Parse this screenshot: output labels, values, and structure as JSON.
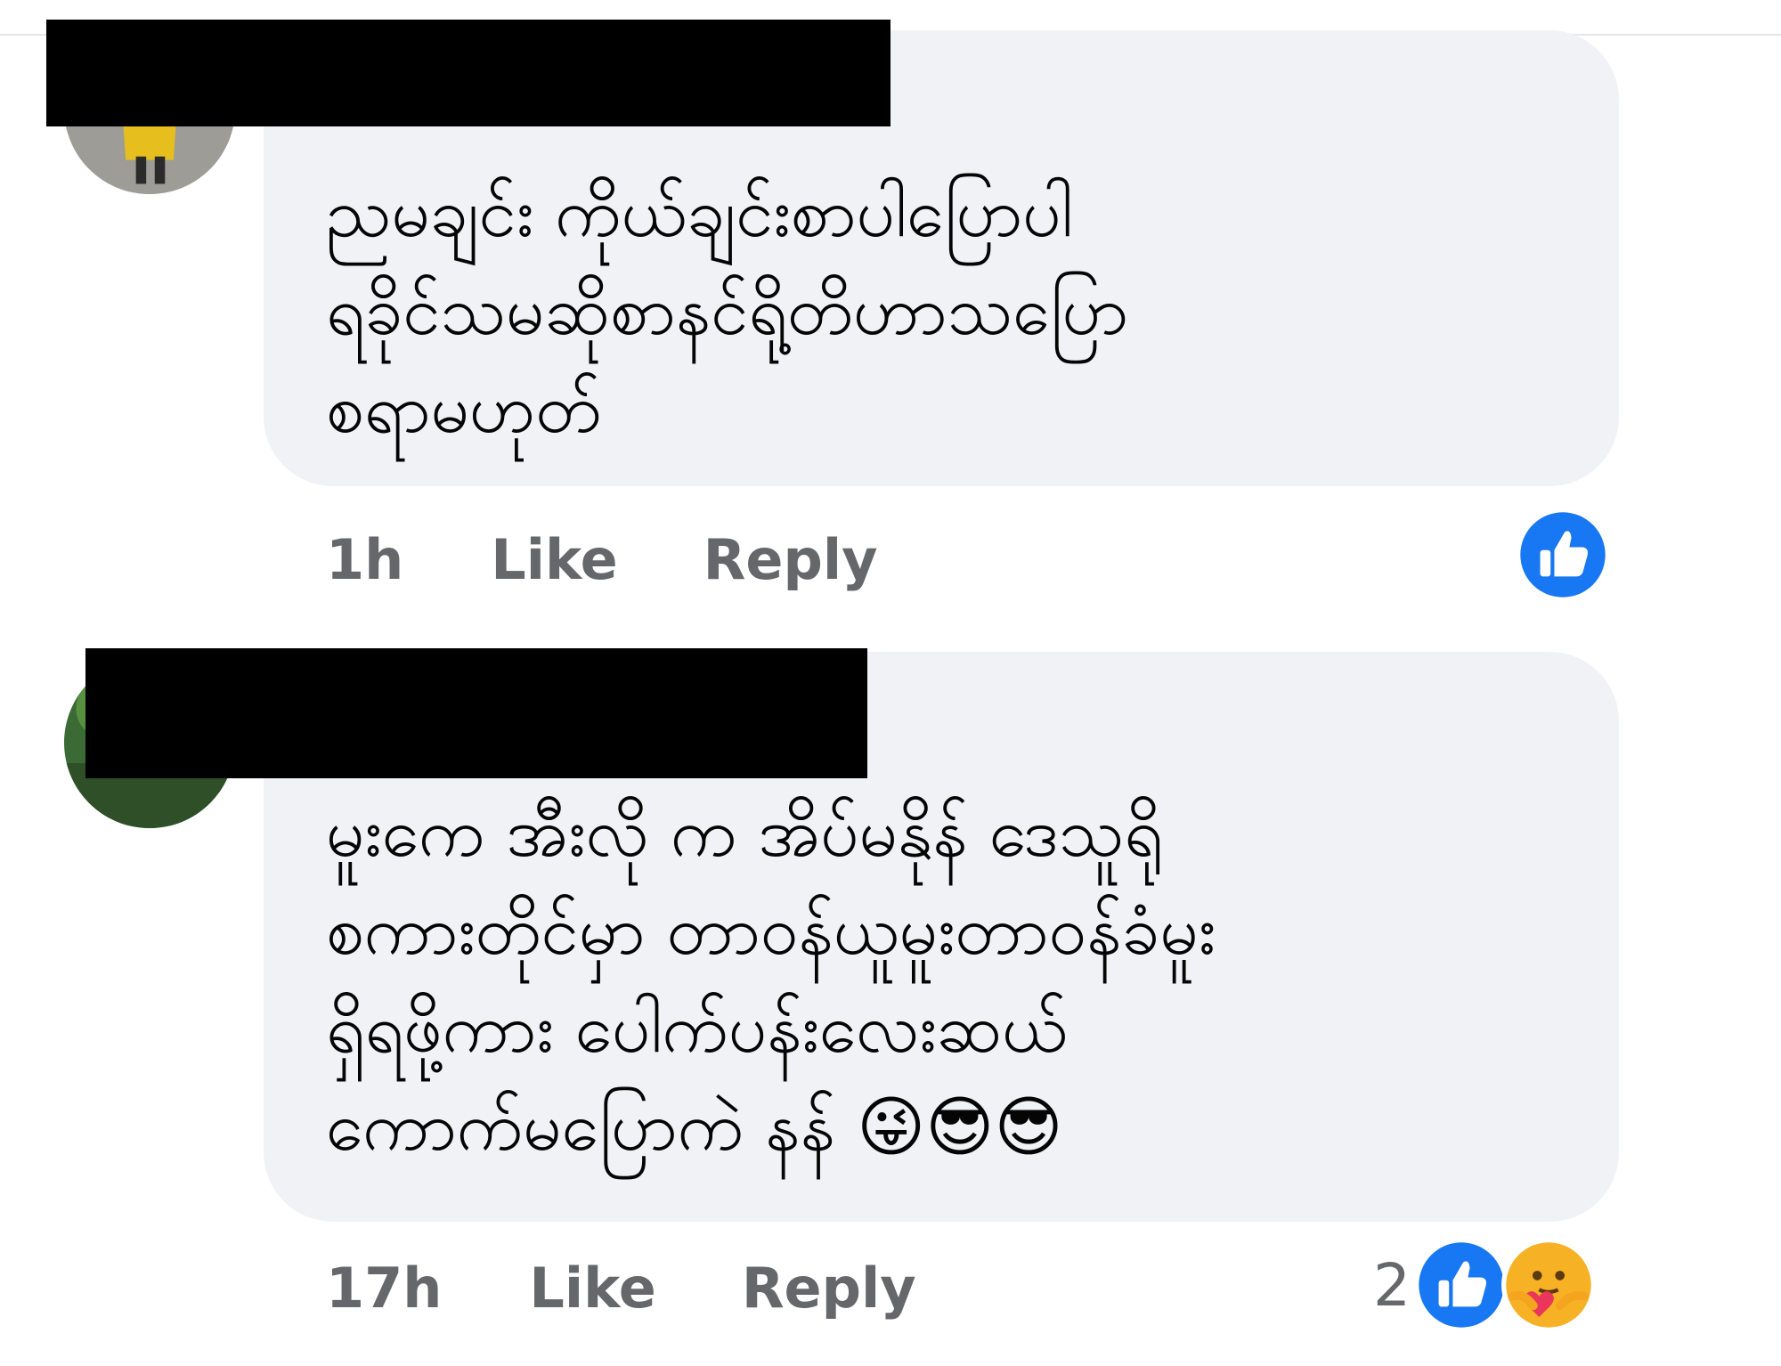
{
  "comments": [
    {
      "text": "ညမချင်း ကိုယ်ချင်းစာပါပြောပါ\nရခိုင်သမဆိုစာနင်ရို့တိဟာသပြော\nစရာမဟုတ်",
      "time": "1h",
      "like_label": "Like",
      "reply_label": "Reply",
      "reactions": {
        "icons": [
          "like-icon"
        ],
        "count": ""
      }
    },
    {
      "text": "မူးကေ အီးလို က အိပ်မနိုန် ဒေသူရို\nစကားတိုင်မှာ တာဝန်ယူမူးတာဝန်ခံမူး\nရှိရဖို့ကား ပေါက်ပန်းလေးဆယ်\nကောက်မပြောကဲ နန်",
      "emojis": [
        "😜",
        "😎",
        "😎"
      ],
      "time": "17h",
      "like_label": "Like",
      "reply_label": "Reply",
      "reactions": {
        "icons": [
          "like-icon",
          "care-icon"
        ],
        "count": "2"
      }
    }
  ],
  "colors": {
    "bubble": "#f0f2f5",
    "meta_text": "#65676b",
    "like_blue": "#1877f2",
    "redaction": "#000000"
  }
}
